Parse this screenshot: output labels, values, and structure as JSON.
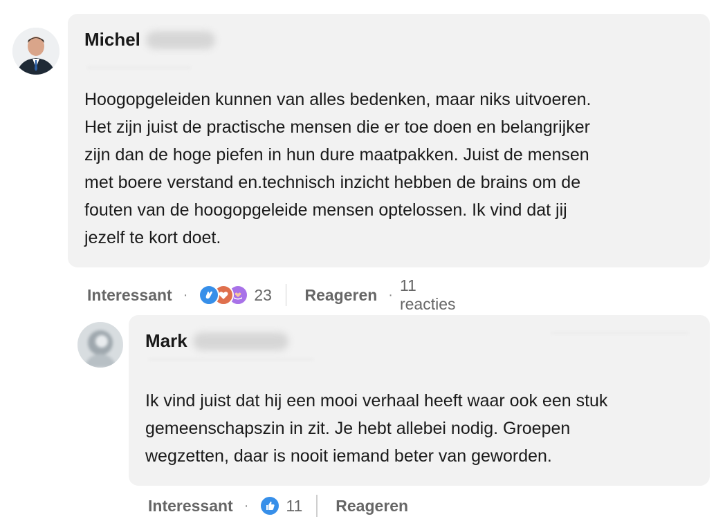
{
  "comments": [
    {
      "author_first": "Michel",
      "text": "Hoogopgeleiden kunnen van alles bedenken, maar niks uitvoeren.\nHet zijn juist de practische mensen die er toe doen en belangrijker\nzijn dan de hoge piefen in hun dure maatpakken. Juist de mensen\nmet boere verstand en.technisch inzicht hebben de brains om de\nfouten van de hoogopgeleide mensen optelossen. Ik vind dat jij\njezelf te kort doet.",
      "like_label": "Interessant",
      "reaction_icons": [
        "clap-icon",
        "heart-icon",
        "support-icon"
      ],
      "reaction_count": "23",
      "reply_label": "Reageren",
      "replies_count": "11 reacties"
    },
    {
      "author_first": "Mark",
      "text": "Ik vind juist dat hij een mooi verhaal heeft waar ook een stuk\ngemeenschapszin in zit. Je hebt allebei nodig. Groepen\nwegzetten, daar is nooit iemand beter van geworden.",
      "like_label": "Interessant",
      "reaction_icons": [
        "thumbs-up-icon"
      ],
      "reaction_count": "11",
      "reply_label": "Reageren"
    }
  ],
  "colors": {
    "bubble": "#f2f2f2",
    "muted_text": "#666666",
    "like_blue": "#378fe9",
    "heart_red": "#df704d",
    "support_purple": "#a872e8"
  }
}
